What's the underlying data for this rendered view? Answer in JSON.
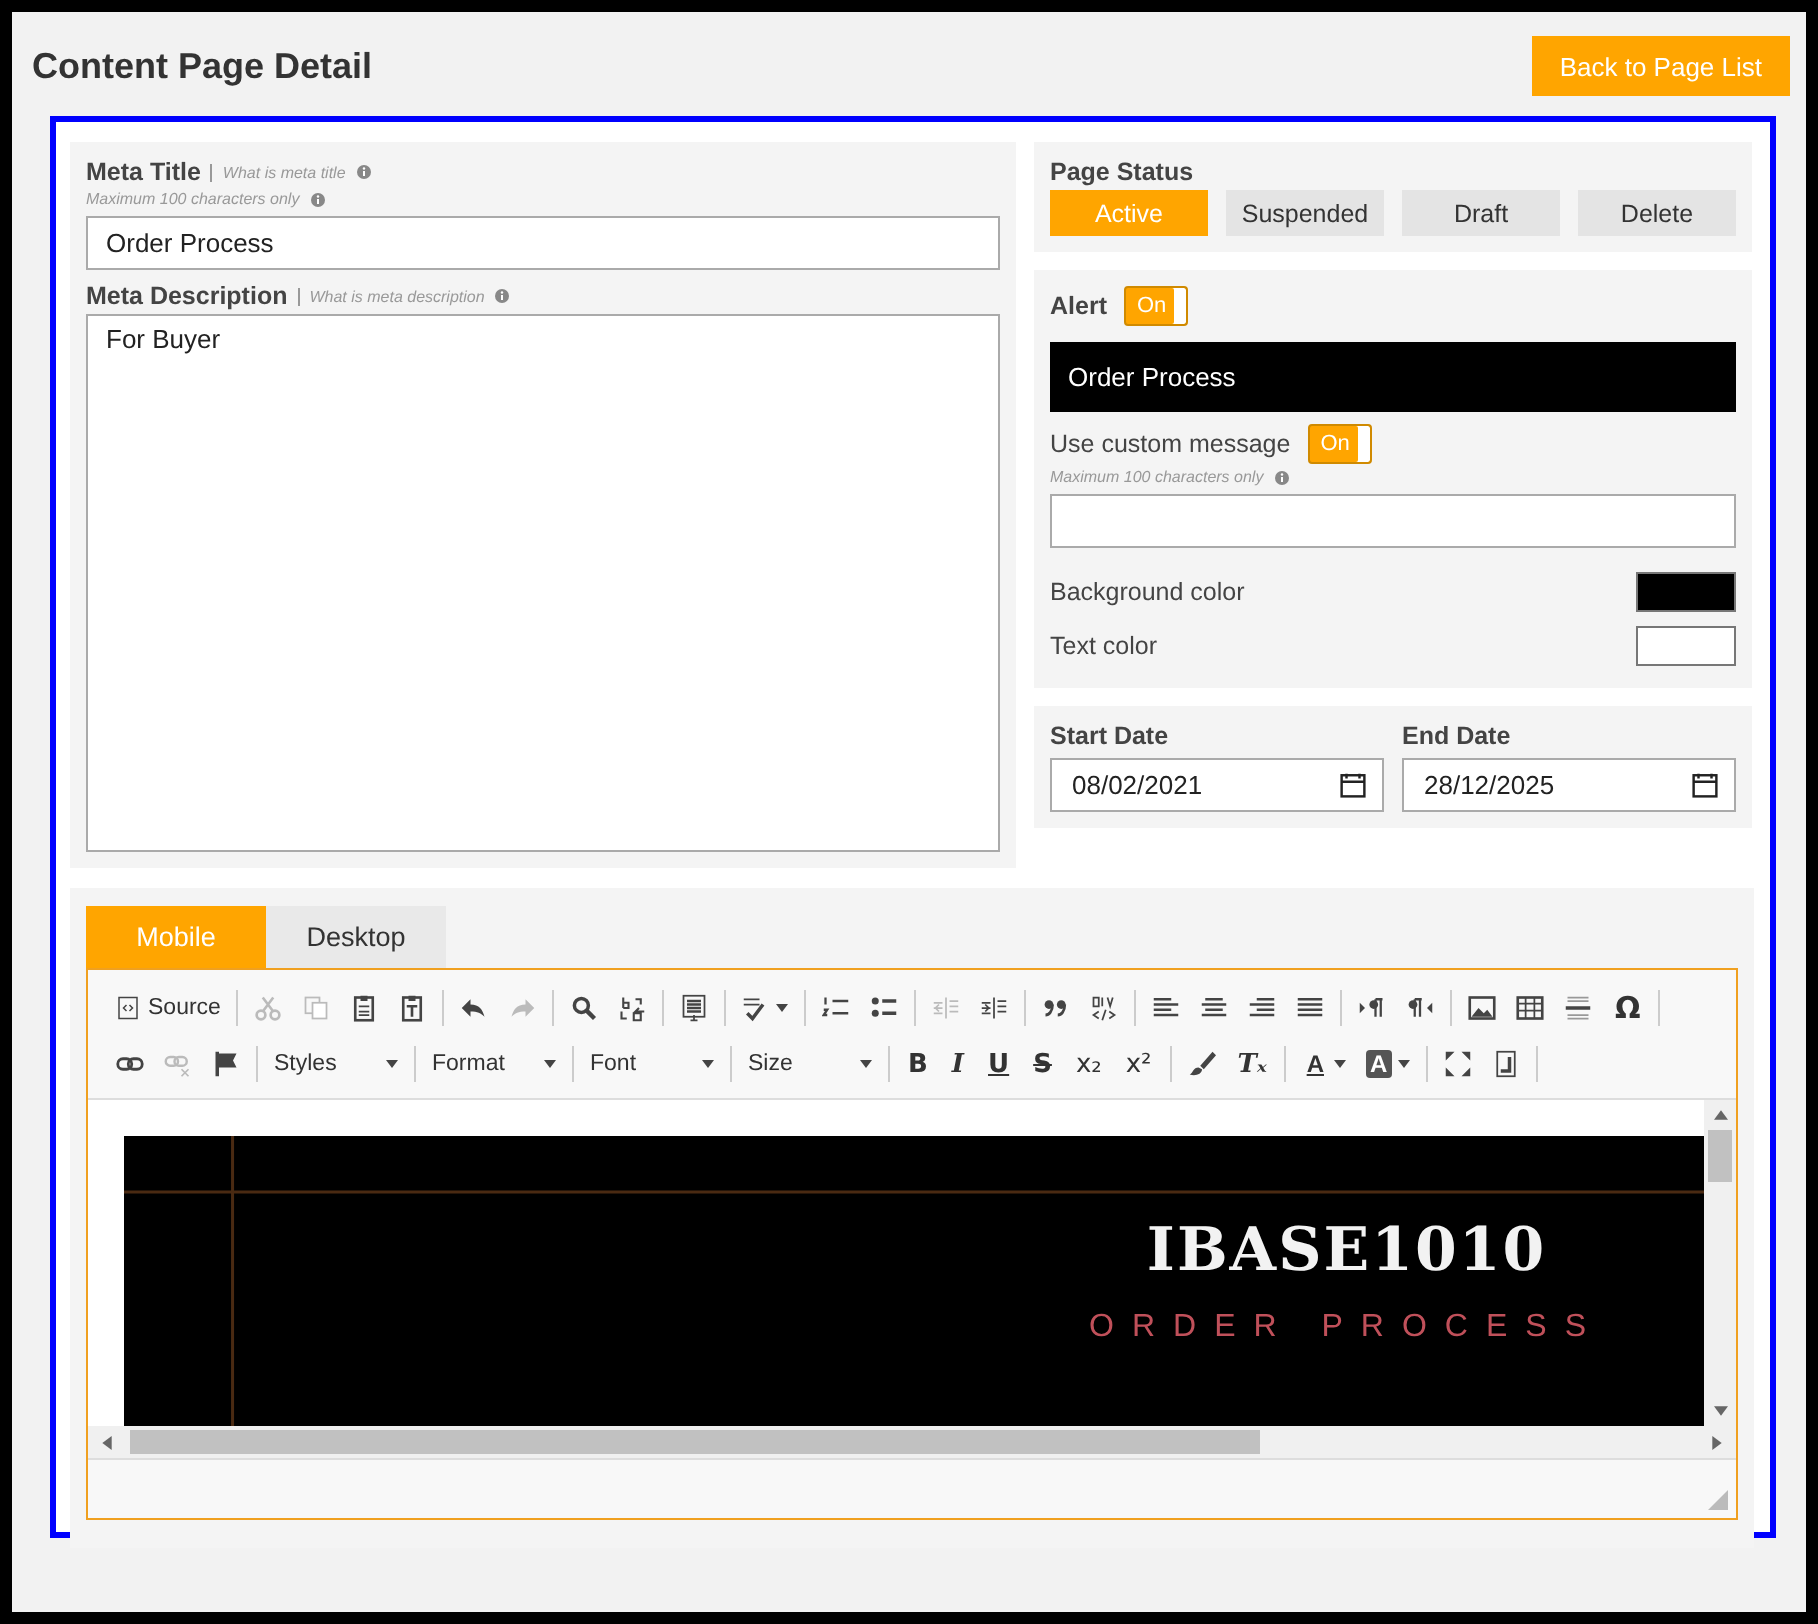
{
  "header": {
    "title": "Content Page Detail",
    "back_button": "Back to Page List"
  },
  "meta": {
    "title_label": "Meta Title",
    "title_hint": "What is meta title",
    "title_limit": "Maximum 100 characters only",
    "title_value": "Order Process",
    "description_label": "Meta Description",
    "description_hint": "What is meta description",
    "description_value": "For Buyer"
  },
  "page_status": {
    "label": "Page Status",
    "options": [
      {
        "label": "Active",
        "selected": true
      },
      {
        "label": "Suspended",
        "selected": false
      },
      {
        "label": "Draft",
        "selected": false
      },
      {
        "label": "Delete",
        "selected": false
      }
    ]
  },
  "alert": {
    "label": "Alert",
    "toggle": {
      "label": "On",
      "on": true
    },
    "preview": "Order Process",
    "custom_label": "Use custom message",
    "custom_toggle": {
      "label": "On",
      "on": true
    },
    "limit": "Maximum 100 characters only",
    "colors": [
      {
        "label": "Background color",
        "color": "#000000"
      },
      {
        "label": "Text color",
        "color": "#ffffff"
      }
    ]
  },
  "dates": [
    {
      "label": "Start Date",
      "value": "08/02/2021"
    },
    {
      "label": "End Date",
      "value": "28/12/2025"
    }
  ],
  "editor": {
    "tabs": [
      {
        "label": "Mobile",
        "selected": true
      },
      {
        "label": "Desktop",
        "selected": false
      }
    ],
    "toolbar": [
      [
        [
          {
            "kind": "source",
            "label": "Source"
          }
        ],
        [
          {
            "kind": "cut",
            "disabled": true
          },
          {
            "kind": "copy",
            "disabled": true
          },
          {
            "kind": "paste",
            "disabled": false
          },
          {
            "kind": "pastetext",
            "disabled": false
          }
        ],
        [
          {
            "kind": "undo",
            "disabled": false
          },
          {
            "kind": "redo",
            "disabled": true
          }
        ],
        [
          {
            "kind": "find",
            "disabled": false
          },
          {
            "kind": "replace",
            "disabled": false
          }
        ],
        [
          {
            "kind": "selectall",
            "disabled": false
          }
        ],
        [
          {
            "kind": "spell",
            "disabled": false
          }
        ],
        [
          {
            "kind": "numlist",
            "disabled": false
          },
          {
            "kind": "bullist",
            "disabled": false
          }
        ],
        [
          {
            "kind": "outdent",
            "disabled": true
          },
          {
            "kind": "indent",
            "disabled": false
          }
        ],
        [
          {
            "kind": "quote",
            "disabled": false
          },
          {
            "kind": "div",
            "disabled": false
          }
        ],
        [
          {
            "kind": "alignleft",
            "disabled": false
          },
          {
            "kind": "aligncenter",
            "disabled": false
          },
          {
            "kind": "alignright",
            "disabled": false
          },
          {
            "kind": "justify",
            "disabled": false
          }
        ],
        [
          {
            "kind": "ltr",
            "disabled": false
          },
          {
            "kind": "rtl",
            "disabled": false
          }
        ],
        [
          {
            "kind": "image",
            "disabled": false
          },
          {
            "kind": "table",
            "disabled": false
          },
          {
            "kind": "hrule",
            "disabled": false
          },
          {
            "kind": "symbol",
            "label": "Ω"
          }
        ]
      ],
      [
        [
          {
            "kind": "link",
            "disabled": false
          },
          {
            "kind": "unlink",
            "disabled": true
          },
          {
            "kind": "flag",
            "disabled": false
          }
        ],
        [
          {
            "kind": "dropdown",
            "label": "Styles"
          }
        ],
        [
          {
            "kind": "dropdown",
            "label": "Format"
          }
        ],
        [
          {
            "kind": "dropdown",
            "label": "Font"
          }
        ],
        [
          {
            "kind": "dropdown",
            "label": "Size"
          }
        ],
        [
          {
            "kind": "bold",
            "label": "B"
          },
          {
            "kind": "italic",
            "label": "I"
          },
          {
            "kind": "underline",
            "label": "U"
          },
          {
            "kind": "strike",
            "label": "S"
          },
          {
            "kind": "subscript",
            "label": "x₂"
          },
          {
            "kind": "superscript",
            "label": "x²"
          }
        ],
        [
          {
            "kind": "brush",
            "disabled": false
          },
          {
            "kind": "removeformat",
            "label": "Tₓ"
          }
        ],
        [
          {
            "kind": "textcolor",
            "label": "A"
          },
          {
            "kind": "bgcolor",
            "label": "A"
          }
        ],
        [
          {
            "kind": "maximize",
            "disabled": false
          },
          {
            "kind": "blocks",
            "disabled": false
          }
        ]
      ]
    ],
    "banner": {
      "title": "IBASE1010",
      "subtitle": "ORDER PROCESS"
    }
  }
}
